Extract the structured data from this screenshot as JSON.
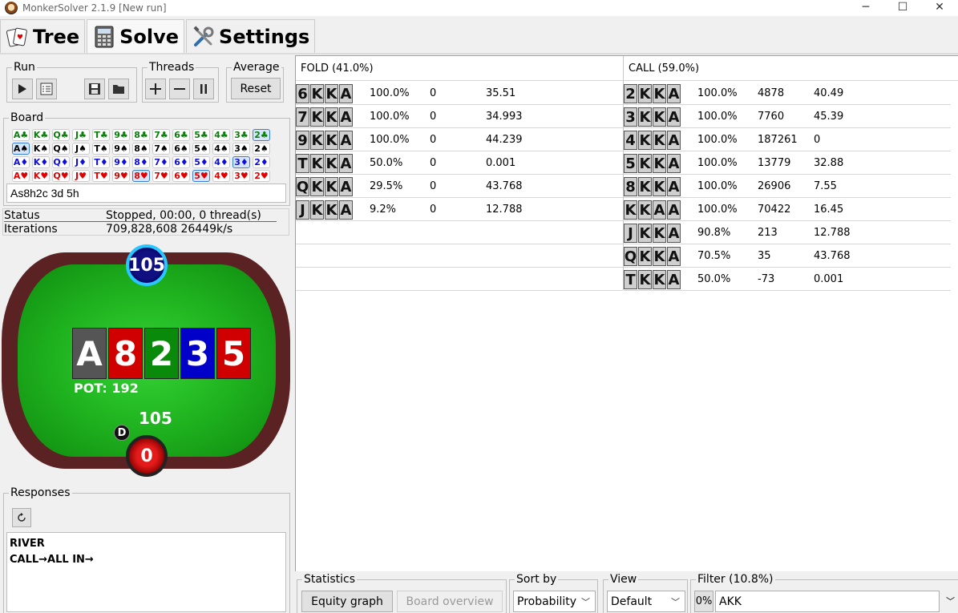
{
  "window": {
    "title": "MonkerSolver 2.1.9 [New run]",
    "controls": [
      "─",
      "☐",
      "✕"
    ]
  },
  "top_tabs": [
    {
      "label": "Tree",
      "icon": "cards-icon"
    },
    {
      "label": "Solve",
      "icon": "calculator-icon"
    },
    {
      "label": "Settings",
      "icon": "tools-icon"
    }
  ],
  "run": {
    "title": "Run"
  },
  "threads": {
    "title": "Threads"
  },
  "average": {
    "title": "Average",
    "reset_label": "Reset"
  },
  "board": {
    "title": "Board",
    "rows": [
      {
        "suit": "c",
        "cells": [
          "A♣",
          "K♣",
          "Q♣",
          "J♣",
          "T♣",
          "9♣",
          "8♣",
          "7♣",
          "6♣",
          "5♣",
          "4♣",
          "3♣",
          "2♣"
        ]
      },
      {
        "suit": "s",
        "cells": [
          "A♠",
          "K♠",
          "Q♠",
          "J♠",
          "T♠",
          "9♠",
          "8♠",
          "7♠",
          "6♠",
          "5♠",
          "4♠",
          "3♠",
          "2♠"
        ]
      },
      {
        "suit": "d",
        "cells": [
          "A♦",
          "K♦",
          "Q♦",
          "J♦",
          "T♦",
          "9♦",
          "8♦",
          "7♦",
          "6♦",
          "5♦",
          "4♦",
          "3♦",
          "2♦"
        ]
      },
      {
        "suit": "h",
        "cells": [
          "A♥",
          "K♥",
          "Q♥",
          "J♥",
          "T♥",
          "9♥",
          "8♥",
          "7♥",
          "6♥",
          "5♥",
          "4♥",
          "3♥",
          "2♥"
        ]
      }
    ],
    "selected": [
      "2♣",
      "A♠",
      "3♦",
      "8♥",
      "5♥"
    ],
    "input_value": "As8h2c 3d 5h"
  },
  "status": {
    "status_label": "Status",
    "status_value": "Stopped, 00:00, 0 thread(s)",
    "iterations_label": "Iterations",
    "iterations_value": "709,828,608  26449k/s"
  },
  "table": {
    "top_stack": "105",
    "bottom_chip": "0",
    "bottom_stack": "105",
    "dealer": "D",
    "pot": "POT: 192",
    "cards": [
      {
        "rank": "A",
        "color": "#555555"
      },
      {
        "rank": "8",
        "color": "#d00000"
      },
      {
        "rank": "2",
        "color": "#0a8a0a"
      },
      {
        "rank": "3",
        "color": "#0000c8"
      },
      {
        "rank": "5",
        "color": "#d00000"
      }
    ]
  },
  "responses": {
    "title": "Responses",
    "refresh_icon": "refresh-icon",
    "lines": [
      "RIVER",
      "CALL→ALL IN→"
    ]
  },
  "results": {
    "fold": {
      "header": "FOLD (41.0%)",
      "rows": [
        {
          "hand": [
            "6",
            "K",
            "K",
            "A"
          ],
          "pct": "100.0%",
          "c2": "0",
          "c3": "35.51"
        },
        {
          "hand": [
            "7",
            "K",
            "K",
            "A"
          ],
          "pct": "100.0%",
          "c2": "0",
          "c3": "34.993"
        },
        {
          "hand": [
            "9",
            "K",
            "K",
            "A"
          ],
          "pct": "100.0%",
          "c2": "0",
          "c3": "44.239"
        },
        {
          "hand": [
            "T",
            "K",
            "K",
            "A"
          ],
          "pct": "50.0%",
          "c2": "0",
          "c3": "0.001"
        },
        {
          "hand": [
            "Q",
            "K",
            "K",
            "A"
          ],
          "pct": "29.5%",
          "c2": "0",
          "c3": "43.768"
        },
        {
          "hand": [
            "J",
            "K",
            "K",
            "A"
          ],
          "pct": "9.2%",
          "c2": "0",
          "c3": "12.788"
        }
      ]
    },
    "call": {
      "header": "CALL (59.0%)",
      "rows": [
        {
          "hand": [
            "2",
            "K",
            "K",
            "A"
          ],
          "pct": "100.0%",
          "c2": "4878",
          "c3": "40.49"
        },
        {
          "hand": [
            "3",
            "K",
            "K",
            "A"
          ],
          "pct": "100.0%",
          "c2": "7760",
          "c3": "45.39"
        },
        {
          "hand": [
            "4",
            "K",
            "K",
            "A"
          ],
          "pct": "100.0%",
          "c2": "187261",
          "c3": "0"
        },
        {
          "hand": [
            "5",
            "K",
            "K",
            "A"
          ],
          "pct": "100.0%",
          "c2": "13779",
          "c3": "32.88"
        },
        {
          "hand": [
            "8",
            "K",
            "K",
            "A"
          ],
          "pct": "100.0%",
          "c2": "26906",
          "c3": "7.55"
        },
        {
          "hand": [
            "K",
            "K",
            "A",
            "A"
          ],
          "pct": "100.0%",
          "c2": "70422",
          "c3": "16.45"
        },
        {
          "hand": [
            "J",
            "K",
            "K",
            "A"
          ],
          "pct": "90.8%",
          "c2": "213",
          "c3": "12.788"
        },
        {
          "hand": [
            "Q",
            "K",
            "K",
            "A"
          ],
          "pct": "70.5%",
          "c2": "35",
          "c3": "43.768"
        },
        {
          "hand": [
            "T",
            "K",
            "K",
            "A"
          ],
          "pct": "50.0%",
          "c2": "-73",
          "c3": "0.001"
        }
      ]
    }
  },
  "bottom": {
    "statistics": {
      "title": "Statistics",
      "equity_graph": "Equity graph",
      "board_overview": "Board overview"
    },
    "sort_by": {
      "title": "Sort by",
      "value": "Probability"
    },
    "view": {
      "title": "View",
      "value": "Default"
    },
    "filter": {
      "title": "Filter (10.8%)",
      "pct_button": "0%",
      "value": "AKK"
    }
  }
}
